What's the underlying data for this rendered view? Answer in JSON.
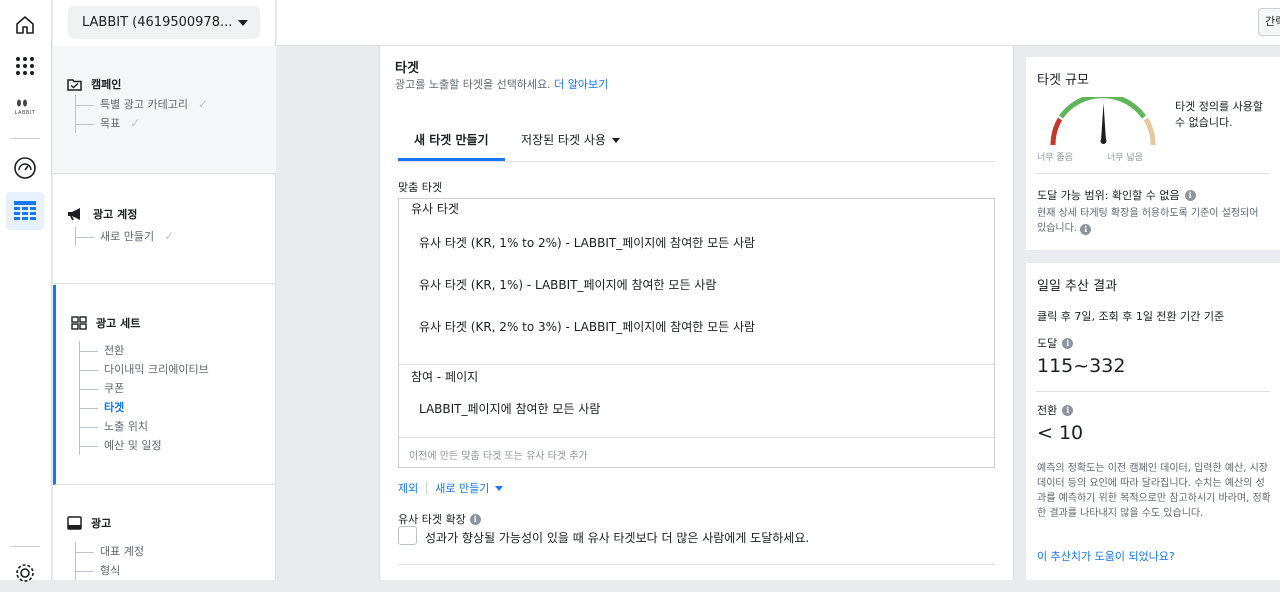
{
  "account": {
    "selector_label": "LABBIT (4619500978..."
  },
  "brand": {
    "logo_text": "LABBIT"
  },
  "topbar": {
    "right_button_label": "간략"
  },
  "nav": {
    "campaign": {
      "title": "캠페인",
      "items": [
        "특별 광고 카테고리",
        "목표"
      ]
    },
    "ad_account": {
      "title": "광고 계정",
      "items": [
        "새로 만들기"
      ]
    },
    "ad_set": {
      "title": "광고 세트",
      "items": [
        "전환",
        "다이내믹 크리에이티브",
        "쿠폰",
        "타겟",
        "노출 위치",
        "예산 및 일정"
      ],
      "active_item": "타겟"
    },
    "ad": {
      "title": "광고",
      "items": [
        "대표 계정",
        "형식"
      ]
    }
  },
  "main": {
    "title": "타겟",
    "description": "광고를 노출할 타겟을 선택하세요.",
    "learn_more": "더 알아보기",
    "tabs": [
      "새 타겟 만들기",
      "저장된 타겟 사용"
    ],
    "custom_audience_label": "맞춤 타겟",
    "groups": [
      {
        "name": "유사 타겟",
        "items": [
          "유사 타겟 (KR, 1% to 2%) - LABBIT_페이지에 참여한 모든 사람",
          "유사 타겟 (KR, 1%) - LABBIT_페이지에 참여한 모든 사람",
          "유사 타겟 (KR, 2% to 3%) - LABBIT_페이지에 참여한 모든 사람"
        ]
      },
      {
        "name": "참여 - 페이지",
        "items": [
          "LABBIT_페이지에 참여한 모든 사람"
        ]
      }
    ],
    "audience_input_placeholder": "이전에 만든 맞춤 타겟 또는 유사 타겟 추가",
    "exclude_label": "제외",
    "create_new_label": "새로 만들기",
    "lookalike_expansion_label": "유사 타겟 확장",
    "lookalike_expansion_text": "성과가 향상될 가능성이 있을 때 유사 타겟보다 더 많은 사람에게 도달하세요."
  },
  "audience_size": {
    "title": "타겟 규모",
    "narrow_label": "너무 좁음",
    "broad_label": "너무 넓음",
    "note": "타겟 정의를 사용할 수 없습니다.",
    "reach_title": "도달 가능 범위: 확인할 수 없음",
    "reach_desc": "현재 상세 타게팅 확장을 허용하도록 기준이 설정되어 있습니다."
  },
  "estimates": {
    "title": "일일 추산 결과",
    "basis": "클릭 후 7일, 조회 후 1일 전환 기간 기준",
    "reach_label": "도달",
    "reach_value": "115~332",
    "conversions_label": "전환",
    "conversions_value": "< 10",
    "disclaimer": "예측의 정확도는 이전 캠페인 데이터, 입력한 예산, 시장 데이터 등의 요인에 따라 달라집니다. 수치는 예산의 성과를 예측하기 위한 목적으로만 참고하시기 바라며, 정확한 결과를 나타내지 않을 수도 있습니다.",
    "feedback_link": "이 추산치가 도움이 되었나요?"
  },
  "colors": {
    "accent": "#1877f2",
    "gauge_red": "#c0392b",
    "gauge_green": "#5eb55a",
    "gauge_tan": "#e8c89a"
  }
}
